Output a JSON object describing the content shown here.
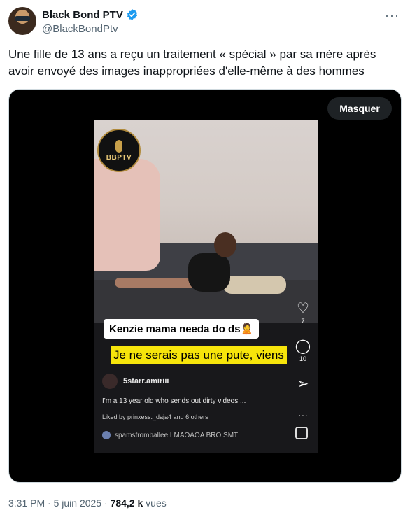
{
  "author": {
    "display_name": "Black Bond PTV",
    "handle": "@BlackBondPtv",
    "verified_icon": "verified-badge-icon",
    "accent": "#1d9bf0"
  },
  "tweet": {
    "text": "Une fille de 13 ans a reçu un traitement « spécial » par sa mère après avoir envoyé des images inappropriées d'elle-même à des hommes"
  },
  "media": {
    "hide_button_label": "Masquer",
    "logo_text": "BBPTV",
    "caption_top": "Kenzie mama needa do ds🙎",
    "caption_subtitle": "Je ne serais pas une pute, viens",
    "side_icons": [
      {
        "icon": "heart-icon",
        "count": "7"
      },
      {
        "icon": "comment-icon",
        "count": "10"
      },
      {
        "icon": "share-icon",
        "count": ""
      },
      {
        "icon": "more-icon",
        "count": ""
      }
    ],
    "username": "5starr.amiriii",
    "description": "I'm a 13 year old who sends out dirty videos ...",
    "liked_by": "Liked by prinxess._daja4 and 6 others",
    "audio": "spamsfromballee LMAOAOA BRO SMT"
  },
  "footer": {
    "time": "3:31 PM",
    "separator": "·",
    "date": "5 juin 2025",
    "views_count": "784,2 k",
    "views_label": "vues"
  }
}
